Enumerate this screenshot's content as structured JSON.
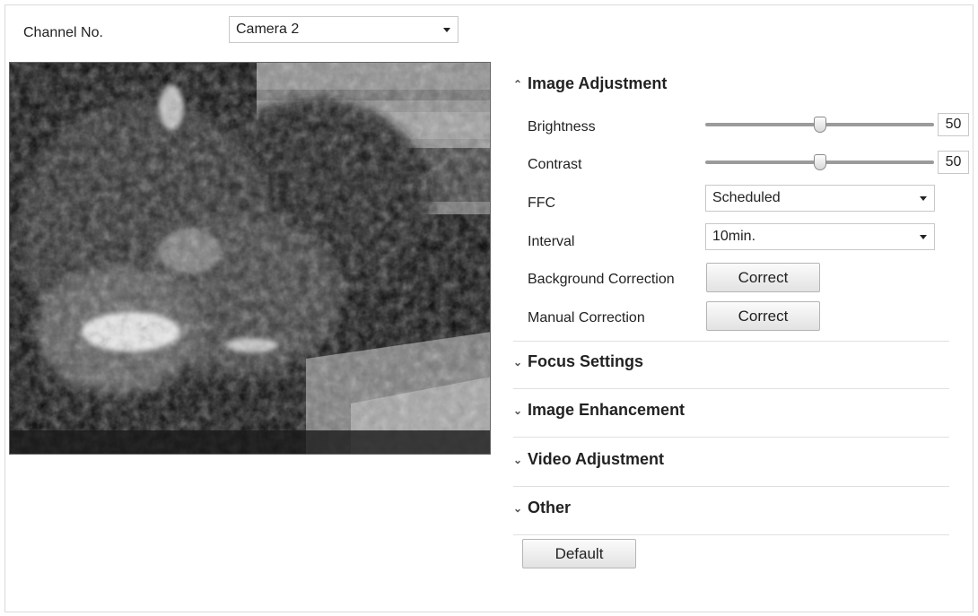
{
  "channel": {
    "label": "Channel No.",
    "selected": "Camera 2"
  },
  "sections": {
    "image_adjustment": "Image Adjustment",
    "focus_settings": "Focus Settings",
    "image_enhancement": "Image Enhancement",
    "video_adjustment": "Video Adjustment",
    "other": "Other"
  },
  "image_adjustment": {
    "brightness": {
      "label": "Brightness",
      "value": "50",
      "level": 0.5
    },
    "contrast": {
      "label": "Contrast",
      "value": "50",
      "level": 0.5
    },
    "ffc": {
      "label": "FFC",
      "selected": "Scheduled"
    },
    "interval": {
      "label": "Interval",
      "selected": "10min."
    },
    "background_correction": {
      "label": "Background Correction",
      "button": "Correct"
    },
    "manual_correction": {
      "label": "Manual Correction",
      "button": "Correct"
    }
  },
  "footer": {
    "default_button": "Default"
  },
  "icons": {
    "expanded": "chevron-up-icon",
    "collapsed": "chevron-down-icon",
    "dropdown": "caret-down-icon"
  }
}
